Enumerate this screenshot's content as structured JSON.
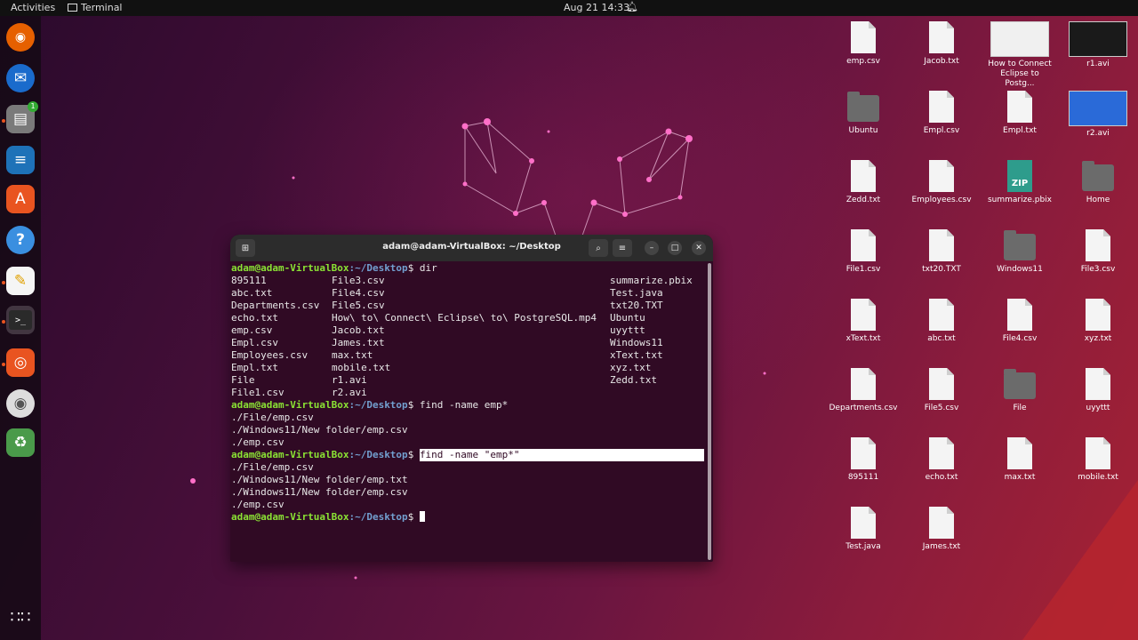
{
  "topbar": {
    "activities": "Activities",
    "app": "Terminal",
    "clock": "Aug 21  14:33"
  },
  "dock": [
    "firefox-icon",
    "thunderbird-icon",
    "files-icon",
    "writer-icon",
    "software-icon",
    "help-icon",
    "text-editor-icon",
    "terminal-icon",
    "ubuntu-icon",
    "disc-icon",
    "trash-icon",
    "app-grid-icon"
  ],
  "files_badge": "1",
  "terminal": {
    "title": "adam@adam-VirtualBox: ~/Desktop",
    "user": "adam@adam-VirtualBox",
    "path": ":~/Desktop",
    "cmd_dir": " dir",
    "dir_col1": [
      "895111",
      "abc.txt",
      "Departments.csv",
      "echo.txt",
      "emp.csv",
      "Empl.csv",
      "Employees.csv",
      "Empl.txt",
      "File",
      "File1.csv"
    ],
    "dir_col2": [
      "File3.csv",
      "File4.csv",
      "File5.csv",
      "How\\ to\\ Connect\\ Eclipse\\ to\\ PostgreSQL.mp4",
      "Jacob.txt",
      "James.txt",
      "max.txt",
      "mobile.txt",
      "r1.avi",
      "r2.avi"
    ],
    "dir_col3": [
      "summarize.pbix",
      "Test.java",
      "txt20.TXT",
      "Ubuntu",
      "uyyttt",
      "Windows11",
      "xText.txt",
      "xyz.txt",
      "Zedd.txt"
    ],
    "cmd_find1": " find -name emp*",
    "out1": [
      "./File/emp.csv",
      "./Windows11/New folder/emp.csv",
      "./emp.csv"
    ],
    "cmd_find2": "find -name \"emp*\"",
    "out2": [
      "./File/emp.csv",
      "./Windows11/New folder/emp.txt",
      "./Windows11/New folder/emp.csv",
      "./emp.csv"
    ]
  },
  "desktop": [
    {
      "label": "emp.csv",
      "kind": "file"
    },
    {
      "label": "Jacob.txt",
      "kind": "file"
    },
    {
      "label": "How to Connect Eclipse to Postg...",
      "kind": "thumb"
    },
    {
      "label": "r1.avi",
      "kind": "thumb-dark"
    },
    {
      "label": "Ubuntu",
      "kind": "folder"
    },
    {
      "label": "Empl.csv",
      "kind": "file"
    },
    {
      "label": "Empl.txt",
      "kind": "file"
    },
    {
      "label": "r2.avi",
      "kind": "thumb-blue"
    },
    {
      "label": "Zedd.txt",
      "kind": "file"
    },
    {
      "label": "Employees.csv",
      "kind": "file"
    },
    {
      "label": "summarize.pbix",
      "kind": "zip"
    },
    {
      "label": "Home",
      "kind": "folder"
    },
    {
      "label": "File1.csv",
      "kind": "file"
    },
    {
      "label": "txt20.TXT",
      "kind": "file"
    },
    {
      "label": "Windows11",
      "kind": "folder"
    },
    {
      "label": "File3.csv",
      "kind": "file"
    },
    {
      "label": "xText.txt",
      "kind": "file"
    },
    {
      "label": "abc.txt",
      "kind": "file"
    },
    {
      "label": "File4.csv",
      "kind": "file"
    },
    {
      "label": "xyz.txt",
      "kind": "file"
    },
    {
      "label": "Departments.csv",
      "kind": "file"
    },
    {
      "label": "File5.csv",
      "kind": "file"
    },
    {
      "label": "File",
      "kind": "folder"
    },
    {
      "label": "uyyttt",
      "kind": "file"
    },
    {
      "label": "895111",
      "kind": "file"
    },
    {
      "label": "echo.txt",
      "kind": "file"
    },
    {
      "label": "max.txt",
      "kind": "file"
    },
    {
      "label": "mobile.txt",
      "kind": "file"
    },
    {
      "label": "Test.java",
      "kind": "file"
    },
    {
      "label": "James.txt",
      "kind": "file"
    }
  ]
}
